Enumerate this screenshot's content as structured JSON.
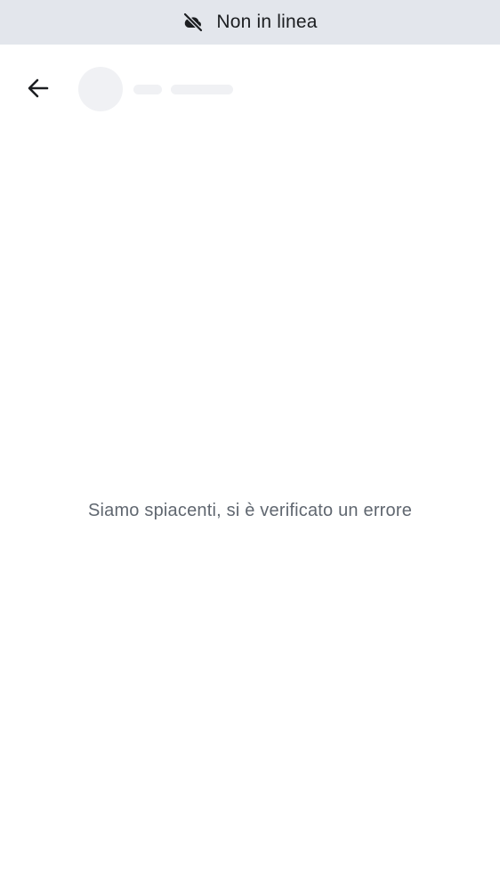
{
  "status_banner": {
    "icon": "cloud-off-icon",
    "text": "Non in linea",
    "background": "#e3e6ec"
  },
  "header": {
    "back_icon": "arrow-left-icon",
    "avatar": "avatar-placeholder",
    "loading": true
  },
  "main": {
    "error_text": "Siamo spiacenti, si è verificato un errore"
  },
  "colors": {
    "banner_bg": "#e3e6ec",
    "text_primary": "#1c1e21",
    "text_secondary": "#606770",
    "skeleton": "#f0f1f4"
  }
}
